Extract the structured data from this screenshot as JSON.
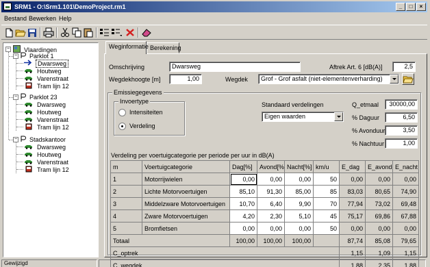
{
  "window": {
    "title": "SRM1 - O:\\Srm1.101\\DemoProject.rm1"
  },
  "menu": [
    {
      "label": "Bestand"
    },
    {
      "label": "Bewerken"
    },
    {
      "label": "Help"
    }
  ],
  "toolbar": {
    "icons": [
      "new-icon",
      "open-icon",
      "save-icon",
      "print-icon",
      "cut-icon",
      "copy-icon",
      "paste-icon",
      "add-road-icon",
      "add-items-icon",
      "delete-icon",
      "eraser-icon"
    ],
    "colors": {
      "delete": "#d42020",
      "open": "#f2c94c"
    }
  },
  "tree": {
    "root": "Vlaardingen",
    "groups": [
      {
        "label": "Parklot 1",
        "items": [
          "Dwarsweg",
          "Houtweg",
          "Varenstraat",
          "Tram lijn 12"
        ]
      },
      {
        "label": "Parklot 23",
        "items": [
          "Dwarsweg",
          "Houtweg",
          "Varenstraat",
          "Tram lijn 12"
        ]
      },
      {
        "label": "Stadskantoor",
        "items": [
          "Dwarsweg",
          "Houtweg",
          "Varenstraat",
          "Tram lijn 12"
        ]
      }
    ]
  },
  "tabs": [
    {
      "label": "Weginformatie",
      "active": true
    },
    {
      "label": "Berekening",
      "active": false
    }
  ],
  "form": {
    "omschrijving_label": "Omschrijving",
    "omschrijving_value": "Dwarsweg",
    "aftrek_label": "Aftrek Art. 6 [dB(A)]",
    "aftrek_value": "2,5",
    "wegdekhoogte_label": "Wegdekhoogte [m]",
    "wegdekhoogte_value": "1,00",
    "wegdek_label": "Wegdek",
    "wegdek_value": "Grof - Grof asfalt (niet-elementenverharding)"
  },
  "emissie": {
    "title": "Emissiegegevens",
    "invoertype_title": "Invoertype",
    "opt_intensiteiten": "Intensiteiten",
    "opt_verdeling": "Verdeling",
    "selected": "Verdeling",
    "standaard_label": "Standaard verdelingen",
    "standaard_value": "Eigen waarden",
    "q_etmaal_label": "Q_etmaal",
    "q_etmaal_value": "30000,00",
    "dagPct_label": "% Daguur",
    "dagPct_value": "6,50",
    "avondPct_label": "% Avonduur",
    "avondPct_value": "3,50",
    "nachtPct_label": "% Nachtuur",
    "nachtPct_value": "1,00",
    "table_caption": "Verdeling per voertuigcategorie per periode per uur in dB(A)"
  },
  "table": {
    "headers": [
      "m",
      "Voertuigcategorie",
      "Dag[%]",
      "Avond[%]",
      "Nacht[%]",
      "km/u",
      "E_dag",
      "E_avond",
      "E_nacht"
    ],
    "rows": [
      [
        "1",
        "Motorrijwielen",
        "0,00",
        "0,00",
        "0,00",
        "50",
        "0,00",
        "0,00",
        "0,00"
      ],
      [
        "2",
        "Lichte Motorvoertuigen",
        "85,10",
        "91,30",
        "85,00",
        "85",
        "83,03",
        "80,65",
        "74,90"
      ],
      [
        "3",
        "Middelzware Motorvoertuigen",
        "10,70",
        "6,40",
        "9,90",
        "70",
        "77,94",
        "73,02",
        "69,48"
      ],
      [
        "4",
        "Zware Motorvoertuigen",
        "4,20",
        "2,30",
        "5,10",
        "45",
        "75,17",
        "69,86",
        "67,88"
      ],
      [
        "5",
        "Bromfietsen",
        "0,00",
        "0,00",
        "0,00",
        "50",
        "0,00",
        "0,00",
        "0,00"
      ]
    ],
    "totaal": [
      "Totaal",
      "100,00",
      "100,00",
      "100,00",
      "87,74",
      "85,08",
      "79,65"
    ],
    "c_optrek": [
      "C_optrek",
      "1,15",
      "1,09",
      "1,15"
    ],
    "c_wegdek": [
      "C_wegdek",
      "1,88",
      "2,35",
      "1,88"
    ]
  },
  "status": {
    "text": "Gewijzigd"
  }
}
